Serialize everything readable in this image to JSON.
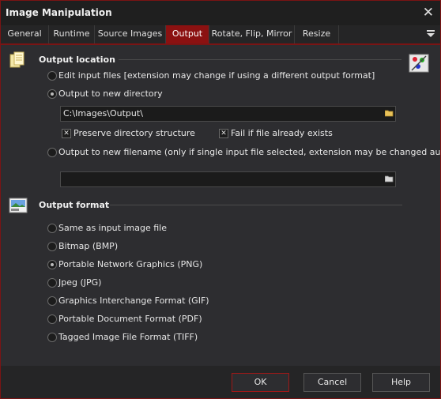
{
  "window": {
    "title": "Image Manipulation"
  },
  "tabs": [
    {
      "label": "General"
    },
    {
      "label": "Runtime"
    },
    {
      "label": "Source Images"
    },
    {
      "label": "Output"
    },
    {
      "label": "Rotate, Flip, Mirror"
    },
    {
      "label": "Resize"
    }
  ],
  "output_location": {
    "title": "Output location",
    "options": [
      {
        "label": "Edit input files [extension may change if using a different output format]",
        "checked": false
      },
      {
        "label": "Output to new directory",
        "checked": true
      },
      {
        "label": "Output to new filename (only if single input file selected, extension may be changed automatically if n",
        "checked": false
      }
    ],
    "directory_value": "C:\\Images\\Output\\",
    "filename_value": "",
    "preserve_label": "Preserve directory structure",
    "preserve_checked": true,
    "fail_label": "Fail if file already exists",
    "fail_checked": true
  },
  "output_format": {
    "title": "Output format",
    "options": [
      {
        "label": "Same as input image file",
        "checked": false
      },
      {
        "label": "Bitmap (BMP)",
        "checked": false
      },
      {
        "label": "Portable Network Graphics (PNG)",
        "checked": true
      },
      {
        "label": "Jpeg (JPG)",
        "checked": false
      },
      {
        "label": "Graphics Interchange Format (GIF)",
        "checked": false
      },
      {
        "label": "Portable Document Format (PDF)",
        "checked": false
      },
      {
        "label": "Tagged Image File Format (TIFF)",
        "checked": false
      }
    ]
  },
  "buttons": {
    "ok": "OK",
    "cancel": "Cancel",
    "help": "Help"
  },
  "colors": {
    "accent": "#8b1111",
    "window_bg": "#2d2d30"
  }
}
